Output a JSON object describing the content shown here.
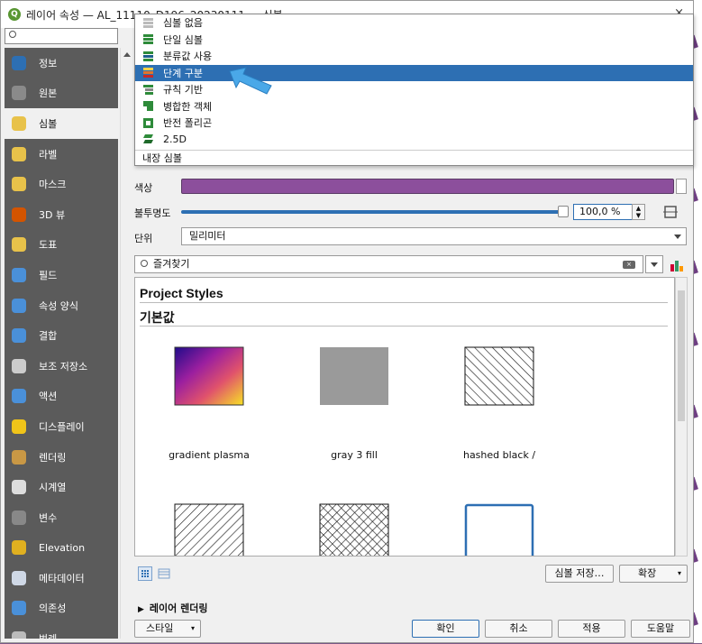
{
  "window": {
    "title": "레이어 속성 — AL_11110_D196_20230111 — 심볼",
    "close": "×"
  },
  "sidebar": {
    "search_placeholder": "",
    "items": [
      {
        "label": "정보",
        "icon": "info-icon"
      },
      {
        "label": "원본",
        "icon": "source-icon"
      },
      {
        "label": "심볼",
        "icon": "symbology-icon"
      },
      {
        "label": "라벨",
        "icon": "labels-icon"
      },
      {
        "label": "마스크",
        "icon": "mask-icon"
      },
      {
        "label": "3D 뷰",
        "icon": "3d-view-icon"
      },
      {
        "label": "도표",
        "icon": "diagrams-icon"
      },
      {
        "label": "필드",
        "icon": "fields-icon"
      },
      {
        "label": "속성 양식",
        "icon": "attributes-form-icon"
      },
      {
        "label": "결합",
        "icon": "joins-icon"
      },
      {
        "label": "보조 저장소",
        "icon": "auxiliary-storage-icon"
      },
      {
        "label": "액션",
        "icon": "actions-icon"
      },
      {
        "label": "디스플레이",
        "icon": "display-icon"
      },
      {
        "label": "렌더링",
        "icon": "rendering-icon"
      },
      {
        "label": "시계열",
        "icon": "temporal-icon"
      },
      {
        "label": "변수",
        "icon": "variables-icon"
      },
      {
        "label": "Elevation",
        "icon": "elevation-icon"
      },
      {
        "label": "메타데이터",
        "icon": "metadata-icon"
      },
      {
        "label": "의존성",
        "icon": "dependencies-icon"
      },
      {
        "label": "범례",
        "icon": "legend-icon"
      }
    ],
    "active_index": 2
  },
  "renderer_menu": {
    "items": [
      {
        "label": "심볼 없음",
        "icon": "no-symbol-icon"
      },
      {
        "label": "단일 심볼",
        "icon": "single-symbol-icon"
      },
      {
        "label": "분류값 사용",
        "icon": "categorized-icon"
      },
      {
        "label": "단계 구분",
        "icon": "graduated-icon"
      },
      {
        "label": "규칙 기반",
        "icon": "rule-based-icon"
      },
      {
        "label": "병합한 객체",
        "icon": "merged-features-icon"
      },
      {
        "label": "반전 폴리곤",
        "icon": "inverted-polygon-icon"
      },
      {
        "label": "2.5D",
        "icon": "2-5d-icon"
      },
      {
        "label": "내장 심볼",
        "icon": ""
      }
    ],
    "selected_index": 3
  },
  "symbol": {
    "color_label": "색상",
    "color_value": "#8c4f9c",
    "opacity_label": "불투명도",
    "opacity_value": "100,0 %",
    "unit_label": "단위",
    "unit_value": "밀리미터"
  },
  "favorites_search": {
    "placeholder": "즐겨찾기"
  },
  "gallery": {
    "group1": "Project Styles",
    "group2": "기본값",
    "symbols": [
      {
        "label": "gradient  plasma"
      },
      {
        "label": "gray 3 fill"
      },
      {
        "label": "hashed black /"
      },
      {
        "label": ""
      },
      {
        "label": ""
      },
      {
        "label": ""
      }
    ]
  },
  "buttons": {
    "save_symbol": "심볼 저장…",
    "advanced": "확장",
    "layer_rendering": "레이어 렌더링",
    "style": "스타일",
    "ok": "확인",
    "cancel": "취소",
    "apply": "적용",
    "help": "도움말"
  },
  "colors": {
    "selection": "#2d6fb3",
    "sidebar_bg": "#5b5b5b",
    "fill_purple": "#8c4f9c"
  }
}
